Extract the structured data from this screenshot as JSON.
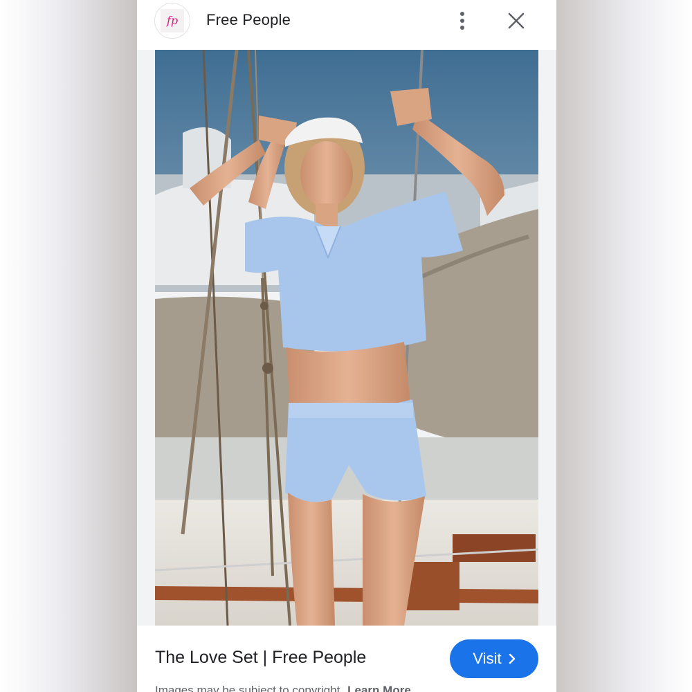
{
  "header": {
    "brand_name": "Free People",
    "logo_text": "fp"
  },
  "image": {
    "alt": "The Love Set | Free People"
  },
  "result": {
    "title": "The Love Set | Free People",
    "visit_label": "Visit"
  },
  "footer": {
    "disclaimer": "Images may be subject to copyright.",
    "learn_more": "Learn More"
  },
  "colors": {
    "accent": "#1a73e8",
    "logo_pink": "#d81b7a",
    "text_primary": "#202124",
    "text_secondary": "#5f6368"
  },
  "icons": {
    "more": "more-vert-icon",
    "close": "close-icon",
    "chevron": "chevron-right-icon"
  }
}
